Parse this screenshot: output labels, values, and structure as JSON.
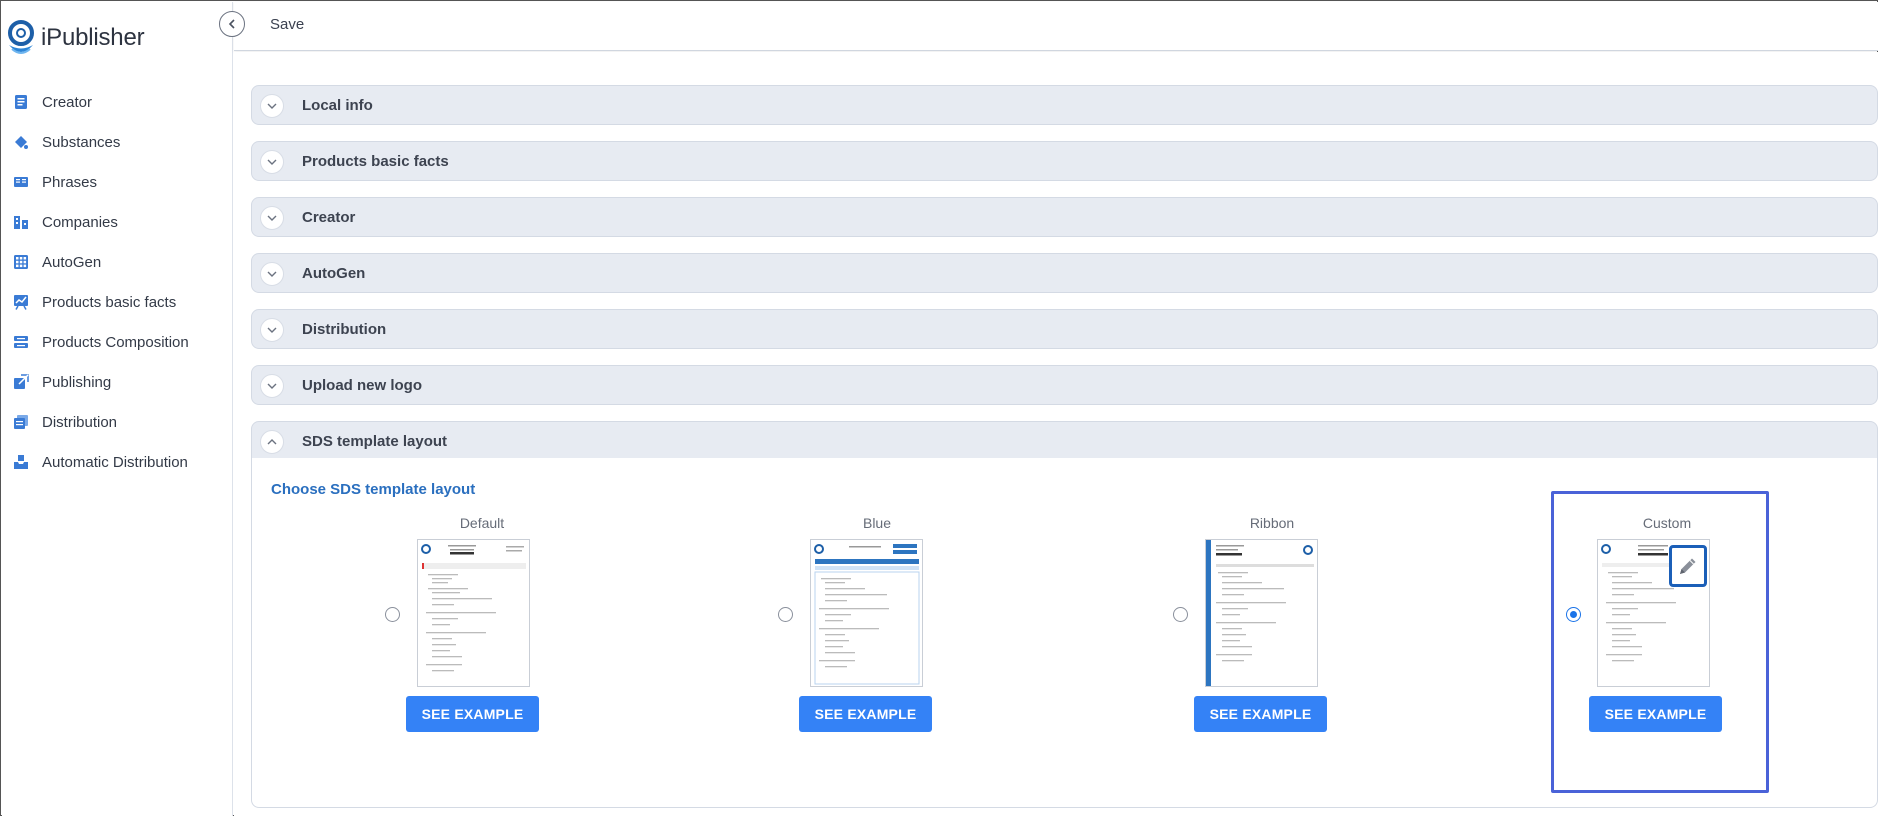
{
  "app": {
    "name": "iPublisher"
  },
  "topbar": {
    "save_label": "Save"
  },
  "sidebar": {
    "items": [
      {
        "label": "Creator",
        "icon": "document-icon"
      },
      {
        "label": "Substances",
        "icon": "paint-bucket-icon"
      },
      {
        "label": "Phrases",
        "icon": "book-icon"
      },
      {
        "label": "Companies",
        "icon": "buildings-icon"
      },
      {
        "label": "AutoGen",
        "icon": "grid-icon"
      },
      {
        "label": "Products basic facts",
        "icon": "chart-board-icon"
      },
      {
        "label": "Products Composition",
        "icon": "layers-icon"
      },
      {
        "label": "Publishing",
        "icon": "publish-icon"
      },
      {
        "label": "Distribution",
        "icon": "stacked-docs-icon"
      },
      {
        "label": "Automatic Distribution",
        "icon": "inbox-tray-icon"
      }
    ]
  },
  "panels": [
    {
      "title": "Local info",
      "expanded": false
    },
    {
      "title": "Products basic facts",
      "expanded": false
    },
    {
      "title": "Creator",
      "expanded": false
    },
    {
      "title": "AutoGen",
      "expanded": false
    },
    {
      "title": "Distribution",
      "expanded": false
    },
    {
      "title": "Upload new logo",
      "expanded": false
    },
    {
      "title": "SDS template layout",
      "expanded": true
    }
  ],
  "sds": {
    "heading": "Choose SDS template layout",
    "options": [
      {
        "label": "Default",
        "button": "SEE EXAMPLE",
        "selected": false
      },
      {
        "label": "Blue",
        "button": "SEE EXAMPLE",
        "selected": false
      },
      {
        "label": "Ribbon",
        "button": "SEE EXAMPLE",
        "selected": false
      },
      {
        "label": "Custom",
        "button": "SEE EXAMPLE",
        "selected": true
      }
    ]
  },
  "colors": {
    "accent": "#3482f6",
    "link": "#2a6fbf",
    "panel_bg": "#e7ebf2",
    "highlight": "#4a62d8"
  }
}
